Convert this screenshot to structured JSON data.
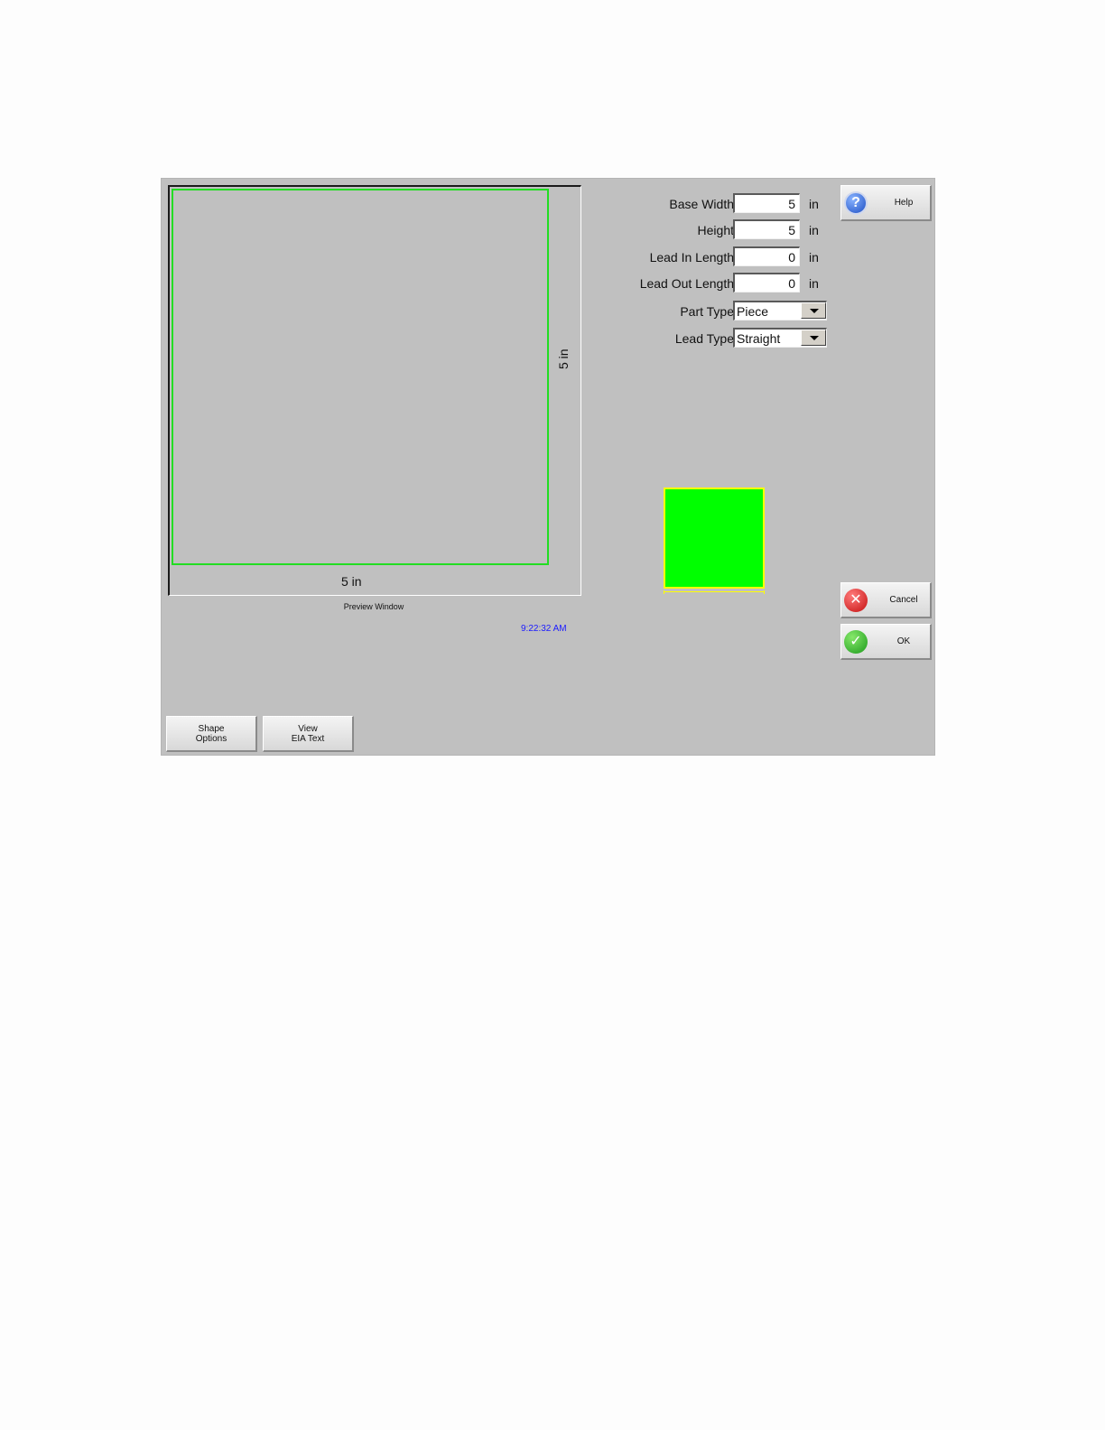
{
  "preview": {
    "width_dim": "5 in",
    "height_dim": "5 in",
    "label": "Preview Window",
    "clock": "9:22:32 AM",
    "outline_color": "#22dd22"
  },
  "form": {
    "base_width": {
      "label": "Base Width",
      "value": "5",
      "unit": "in"
    },
    "height": {
      "label": "Height",
      "value": "5",
      "unit": "in"
    },
    "lead_in_length": {
      "label": "Lead In Length",
      "value": "0",
      "unit": "in"
    },
    "lead_out_length": {
      "label": "Lead Out Length",
      "value": "0",
      "unit": "in"
    },
    "part_type": {
      "label": "Part Type",
      "value": "Piece"
    },
    "lead_type": {
      "label": "Lead Type",
      "value": "Straight"
    }
  },
  "thumbnail": {
    "fill": "#00ff00",
    "border": "#ffff00"
  },
  "buttons": {
    "help": "Help",
    "cancel": "Cancel",
    "ok": "OK",
    "shape_options_1": "Shape",
    "shape_options_2": "Options",
    "view_eia_1": "View",
    "view_eia_2": "EIA Text"
  },
  "icons": {
    "help": "question-icon",
    "cancel": "x-icon",
    "ok": "check-icon"
  }
}
